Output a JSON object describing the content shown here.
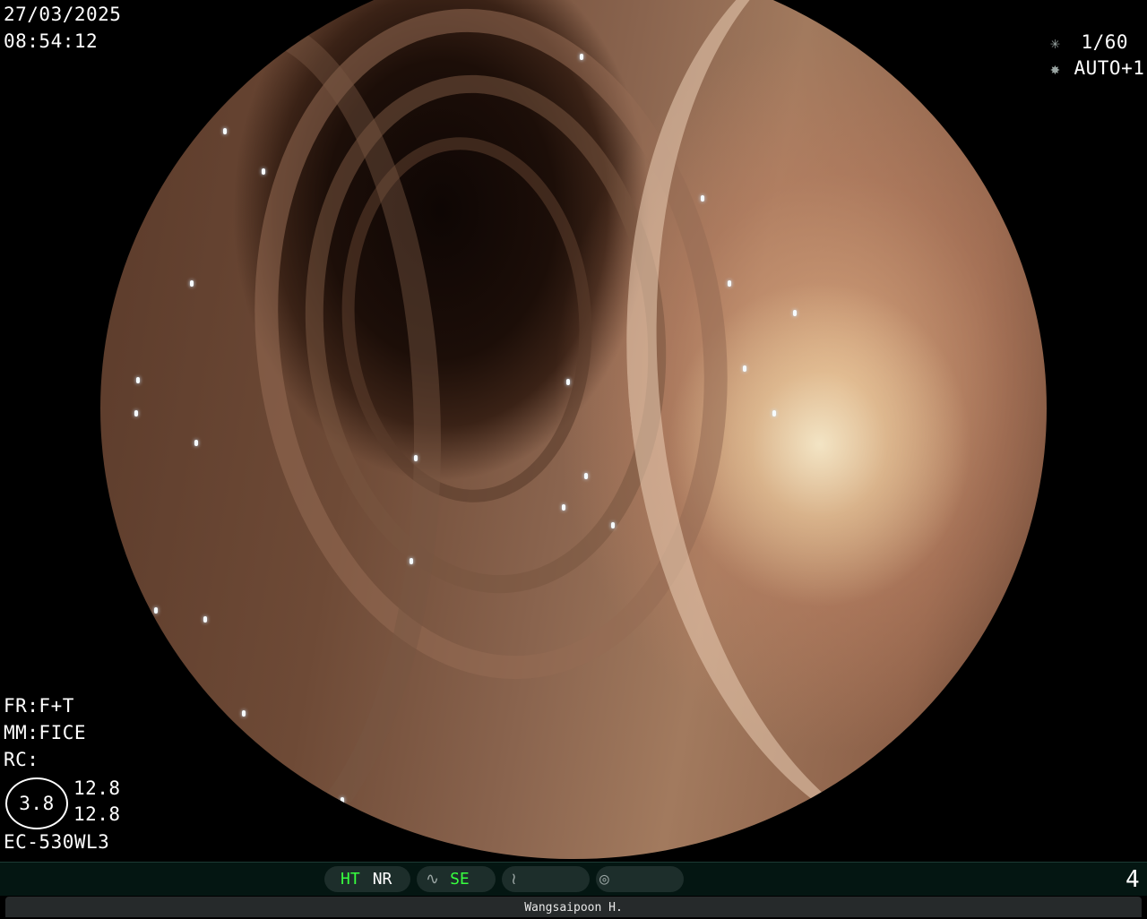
{
  "datetime": {
    "date": "27/03/2025",
    "time": "08:54:12"
  },
  "settings": {
    "shutter": "1/60",
    "iris": "AUTO+1"
  },
  "processor": {
    "fr": "FR:F+T",
    "mm": "MM:FICE",
    "rc": "RC:"
  },
  "enhancement": {
    "value": "3.8",
    "top": "12.8",
    "bottom": "12.8"
  },
  "scope_model": "EC-530WL3",
  "modes": {
    "ht": "HT",
    "nr": "NR",
    "se": "SE"
  },
  "page_number": "4",
  "operator": "Wangsaipoon H.",
  "colors": {
    "active_mode": "#37ff3f",
    "bar": "#041612",
    "footer": "#262a2b"
  },
  "icons": [
    "shutter-icon",
    "iris-icon",
    "structure-enhance-icon",
    "color-enhance-icon",
    "lesion-icon"
  ]
}
